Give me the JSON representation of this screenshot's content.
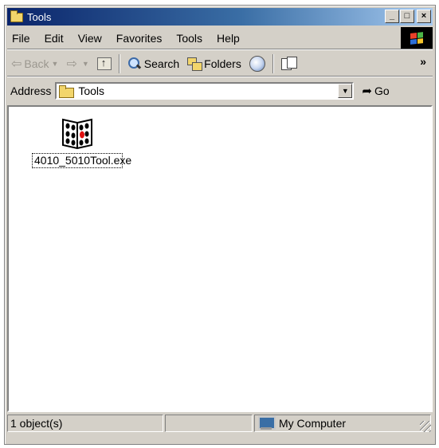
{
  "window": {
    "title": "Tools"
  },
  "title_buttons": {
    "minimize": "_",
    "maximize": "□",
    "close": "×"
  },
  "menubar": {
    "items": [
      "File",
      "Edit",
      "View",
      "Favorites",
      "Tools",
      "Help"
    ]
  },
  "toolbar": {
    "back_label": "Back",
    "search_label": "Search",
    "folders_label": "Folders",
    "overflow": "»"
  },
  "address": {
    "label": "Address",
    "value": "Tools",
    "go_label": "Go"
  },
  "files": [
    {
      "name": "4010_5010Tool.exe",
      "icon": "application-icon"
    }
  ],
  "statusbar": {
    "object_count": "1 object(s)",
    "zone": "My Computer"
  }
}
